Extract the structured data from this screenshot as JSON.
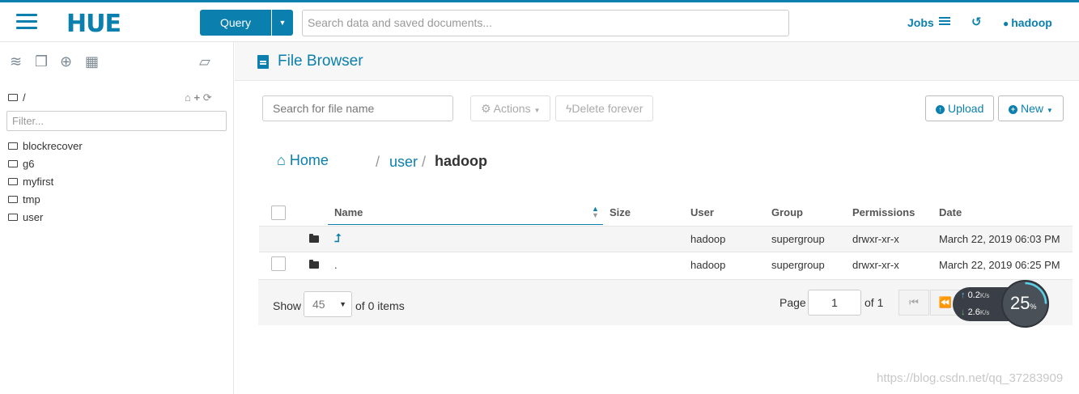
{
  "app": {
    "logo": "HUE"
  },
  "navbar": {
    "query_label": "Query",
    "search_placeholder": "Search data and saved documents...",
    "jobs_label": "Jobs",
    "user_label": "hadoop"
  },
  "left_panel": {
    "root_path": "/",
    "filter_placeholder": "Filter...",
    "items": [
      {
        "label": "blockrecover"
      },
      {
        "label": "g6"
      },
      {
        "label": "myfirst"
      },
      {
        "label": "tmp"
      },
      {
        "label": "user"
      }
    ]
  },
  "main": {
    "title": "File Browser",
    "search_placeholder": "Search for file name",
    "actions_label": "Actions",
    "delete_label": "Delete forever",
    "upload_label": "Upload",
    "new_label": "New",
    "breadcrumb": {
      "home": "Home",
      "sep": "/",
      "user": "user",
      "current": "hadoop"
    },
    "columns": {
      "name": "Name",
      "size": "Size",
      "user": "User",
      "group": "Group",
      "permissions": "Permissions",
      "date": "Date"
    },
    "rows": [
      {
        "name": "",
        "user": "hadoop",
        "group": "supergroup",
        "permissions": "drwxr-xr-x",
        "date": "March 22, 2019 06:03 PM"
      },
      {
        "name": ".",
        "user": "hadoop",
        "group": "supergroup",
        "permissions": "drwxr-xr-x",
        "date": "March 22, 2019 06:25 PM"
      }
    ],
    "footer": {
      "show_label": "Show",
      "page_size": "45",
      "items_text": "of 0 items",
      "page_label": "Page",
      "page_value": "1",
      "of_pages": "of 1"
    }
  },
  "overlay": {
    "upload_speed": "0.2",
    "download_speed": "2.6",
    "speed_unit": "K/s",
    "percent": "25",
    "percent_unit": "%",
    "watermark": "https://blog.csdn.net/qq_37283909"
  },
  "colors": {
    "accent": "#0b7fad"
  }
}
